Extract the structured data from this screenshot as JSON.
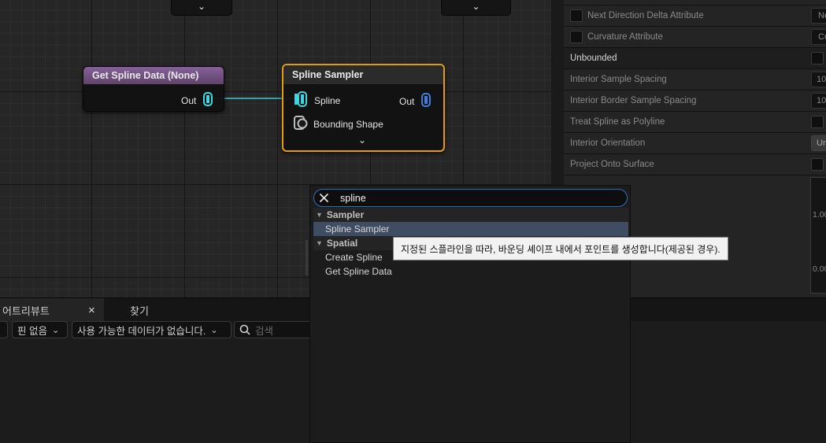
{
  "graph": {
    "node_get_spline": {
      "title": "Get Spline Data (None)",
      "out_label": "Out",
      "header_color": "#7c5a86"
    },
    "node_spline_sampler": {
      "title": "Spline Sampler",
      "pin_spline": "Spline",
      "pin_bounding": "Bounding Shape",
      "out_label": "Out",
      "border_color": "#e49b12"
    },
    "wire_color": "#3fc8d8"
  },
  "palette": {
    "search_value": "spline",
    "categories": [
      {
        "label": "Sampler",
        "items": [
          "Spline Sampler"
        ]
      },
      {
        "label": "Spatial",
        "items": [
          "Create Spline",
          "Get Spline Data"
        ]
      }
    ],
    "tooltip": "지정된 스플라인을 따라, 바운딩 셰이프 내에서 포인트를 생성합니다(제공된 경우)."
  },
  "details": {
    "rows": [
      {
        "label": "Next Direction Delta Attribute",
        "value": "Ne"
      },
      {
        "label": "Curvature Attribute",
        "value": "Cu"
      },
      {
        "label": "Unbounded",
        "value": ""
      },
      {
        "label": "Interior Sample Spacing",
        "value": "10"
      },
      {
        "label": "Interior Border Sample Spacing",
        "value": "10"
      },
      {
        "label": "Treat Spline as Polyline",
        "value": ""
      },
      {
        "label": "Interior Orientation",
        "value": "Un"
      },
      {
        "label": "Project Onto Surface",
        "value": ""
      }
    ],
    "curve_value_top": "1.00",
    "curve_value_bottom": "0.00"
  },
  "bottom": {
    "tab_attributes": "어트리뷰트",
    "tab_close": "×",
    "tab_find": "찾기",
    "pins_combo": "핀 없음",
    "data_combo": "사용 가능한 데이터가 없습니다.",
    "search_placeholder": "검색"
  }
}
